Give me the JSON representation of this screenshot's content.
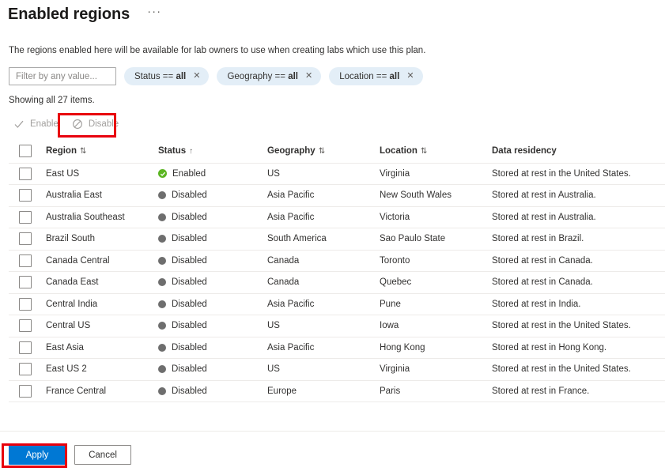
{
  "header": {
    "title": "Enabled regions",
    "ellipsis_label": "···",
    "ellipsis_icon": "more-horizontal-icon"
  },
  "description": "The regions enabled here will be available for lab owners to use when creating labs which use this plan.",
  "filter_bar": {
    "input_placeholder": "Filter by any value...",
    "input_value": "",
    "pills": [
      {
        "field": "Status",
        "operator": "==",
        "value": "all",
        "close_icon": "close-icon"
      },
      {
        "field": "Geography",
        "operator": "==",
        "value": "all",
        "close_icon": "close-icon"
      },
      {
        "field": "Location",
        "operator": "==",
        "value": "all",
        "close_icon": "close-icon"
      }
    ]
  },
  "showing_count": "Showing all 27 items.",
  "command_bar": {
    "enable": {
      "label": "Enable",
      "icon": "checkmark-icon",
      "disabled": true
    },
    "disable": {
      "label": "Disable",
      "icon": "block-icon",
      "disabled": true
    }
  },
  "table": {
    "select_all_checkbox": false,
    "columns": [
      {
        "label": "Region",
        "sort": "sortable"
      },
      {
        "label": "Status",
        "sort": "ascending"
      },
      {
        "label": "Geography",
        "sort": "sortable"
      },
      {
        "label": "Location",
        "sort": "sortable"
      },
      {
        "label": "Data residency",
        "sort": "none"
      }
    ],
    "sort_glyphs": {
      "sortable": "⇅",
      "ascending": "↑",
      "none": ""
    },
    "rows": [
      {
        "checked": false,
        "region": "East US",
        "status": "Enabled",
        "status_icon": "enabled-check-icon",
        "geography": "US",
        "location": "Virginia",
        "residency": "Stored at rest in the United States."
      },
      {
        "checked": false,
        "region": "Australia East",
        "status": "Disabled",
        "status_icon": "disabled-dot-icon",
        "geography": "Asia Pacific",
        "location": "New South Wales",
        "residency": "Stored at rest in Australia."
      },
      {
        "checked": false,
        "region": "Australia Southeast",
        "status": "Disabled",
        "status_icon": "disabled-dot-icon",
        "geography": "Asia Pacific",
        "location": "Victoria",
        "residency": "Stored at rest in Australia."
      },
      {
        "checked": false,
        "region": "Brazil South",
        "status": "Disabled",
        "status_icon": "disabled-dot-icon",
        "geography": "South America",
        "location": "Sao Paulo State",
        "residency": "Stored at rest in Brazil."
      },
      {
        "checked": false,
        "region": "Canada Central",
        "status": "Disabled",
        "status_icon": "disabled-dot-icon",
        "geography": "Canada",
        "location": "Toronto",
        "residency": "Stored at rest in Canada."
      },
      {
        "checked": false,
        "region": "Canada East",
        "status": "Disabled",
        "status_icon": "disabled-dot-icon",
        "geography": "Canada",
        "location": "Quebec",
        "residency": "Stored at rest in Canada."
      },
      {
        "checked": false,
        "region": "Central India",
        "status": "Disabled",
        "status_icon": "disabled-dot-icon",
        "geography": "Asia Pacific",
        "location": "Pune",
        "residency": "Stored at rest in India."
      },
      {
        "checked": false,
        "region": "Central US",
        "status": "Disabled",
        "status_icon": "disabled-dot-icon",
        "geography": "US",
        "location": "Iowa",
        "residency": "Stored at rest in the United States."
      },
      {
        "checked": false,
        "region": "East Asia",
        "status": "Disabled",
        "status_icon": "disabled-dot-icon",
        "geography": "Asia Pacific",
        "location": "Hong Kong",
        "residency": "Stored at rest in Hong Kong."
      },
      {
        "checked": false,
        "region": "East US 2",
        "status": "Disabled",
        "status_icon": "disabled-dot-icon",
        "geography": "US",
        "location": "Virginia",
        "residency": "Stored at rest in the United States."
      },
      {
        "checked": false,
        "region": "France Central",
        "status": "Disabled",
        "status_icon": "disabled-dot-icon",
        "geography": "Europe",
        "location": "Paris",
        "residency": "Stored at rest in France."
      }
    ]
  },
  "footer": {
    "apply_label": "Apply",
    "cancel_label": "Cancel"
  },
  "annotations": [
    {
      "name": "disable-button-highlight",
      "color": "#e8000d"
    },
    {
      "name": "apply-button-highlight",
      "color": "#e8000d"
    }
  ],
  "colors": {
    "accent": "#0078d4",
    "enabled_green": "#5bb522",
    "disabled_gray": "#6e6e6e",
    "pill_background": "#e3eef7",
    "annotation_red": "#e8000d"
  }
}
